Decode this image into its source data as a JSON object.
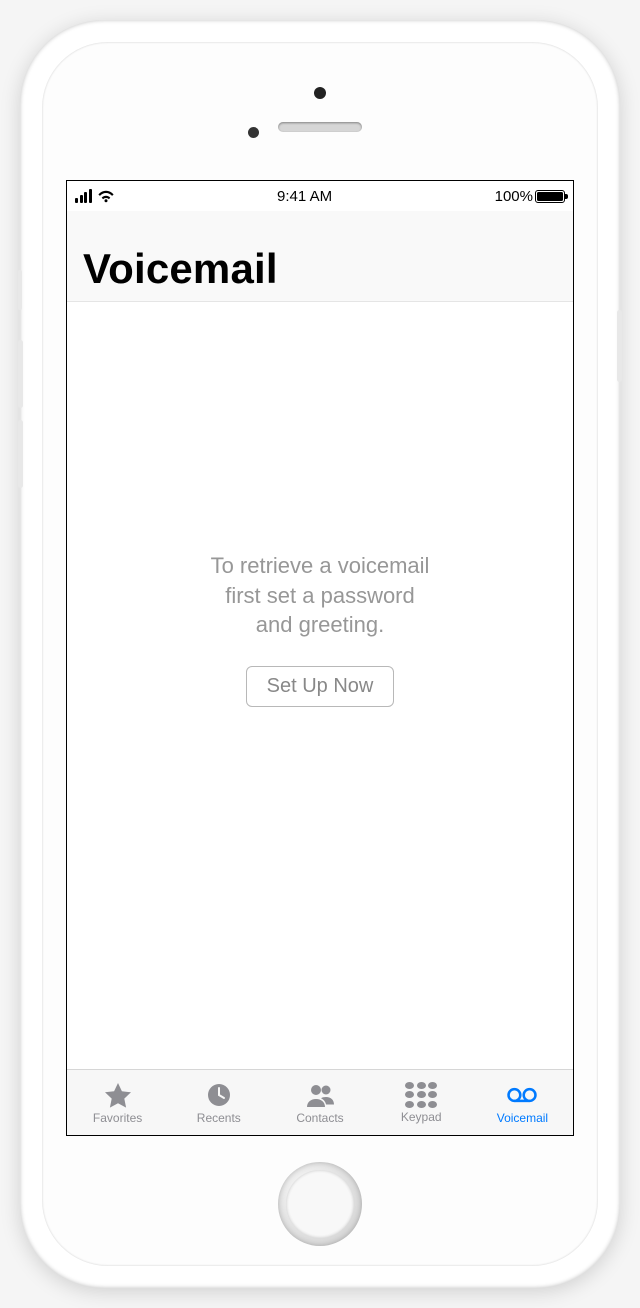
{
  "status_bar": {
    "time": "9:41 AM",
    "battery_pct": "100%"
  },
  "header": {
    "title": "Voicemail"
  },
  "empty_state": {
    "line1": "To retrieve a voicemail",
    "line2": "first set a password",
    "line3": "and greeting.",
    "button": "Set Up Now"
  },
  "tabs": {
    "favorites": "Favorites",
    "recents": "Recents",
    "contacts": "Contacts",
    "keypad": "Keypad",
    "voicemail": "Voicemail"
  },
  "colors": {
    "tint": "#007aff",
    "inactive": "#8e8e93",
    "text_muted": "#979797"
  }
}
